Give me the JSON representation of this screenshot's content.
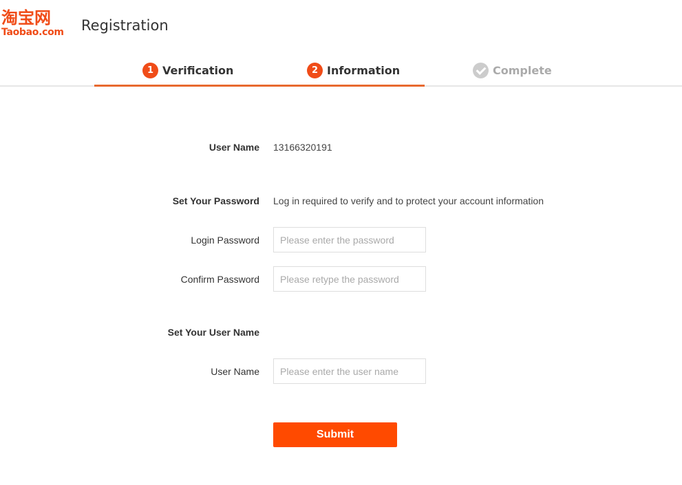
{
  "header": {
    "logo_cn": "淘宝网",
    "logo_en": "Taobao.com",
    "title": "Registration"
  },
  "steps": [
    {
      "number": "1",
      "label": "Verification",
      "state": "done"
    },
    {
      "number": "2",
      "label": "Information",
      "state": "current"
    },
    {
      "number": "",
      "label": "Complete",
      "state": "pending",
      "icon": "check-circle-icon"
    }
  ],
  "colors": {
    "brand": "#f04c18",
    "progress": "#e8692f",
    "submit": "#ff4a00",
    "pending": "#cccccc"
  },
  "form": {
    "username_label": "User Name",
    "username_value": "13166320191",
    "password_section_label": "Set Your Password",
    "password_section_note": "Log in required to verify and to protect your account information",
    "login_password_label": "Login Password",
    "login_password_placeholder": "Please enter the password",
    "login_password_value": "",
    "confirm_password_label": "Confirm Password",
    "confirm_password_placeholder": "Please retype the password",
    "confirm_password_value": "",
    "set_username_section_label": "Set Your User Name",
    "new_username_label": "User Name",
    "new_username_placeholder": "Please enter the user name",
    "new_username_value": "",
    "submit_label": "Submit"
  }
}
